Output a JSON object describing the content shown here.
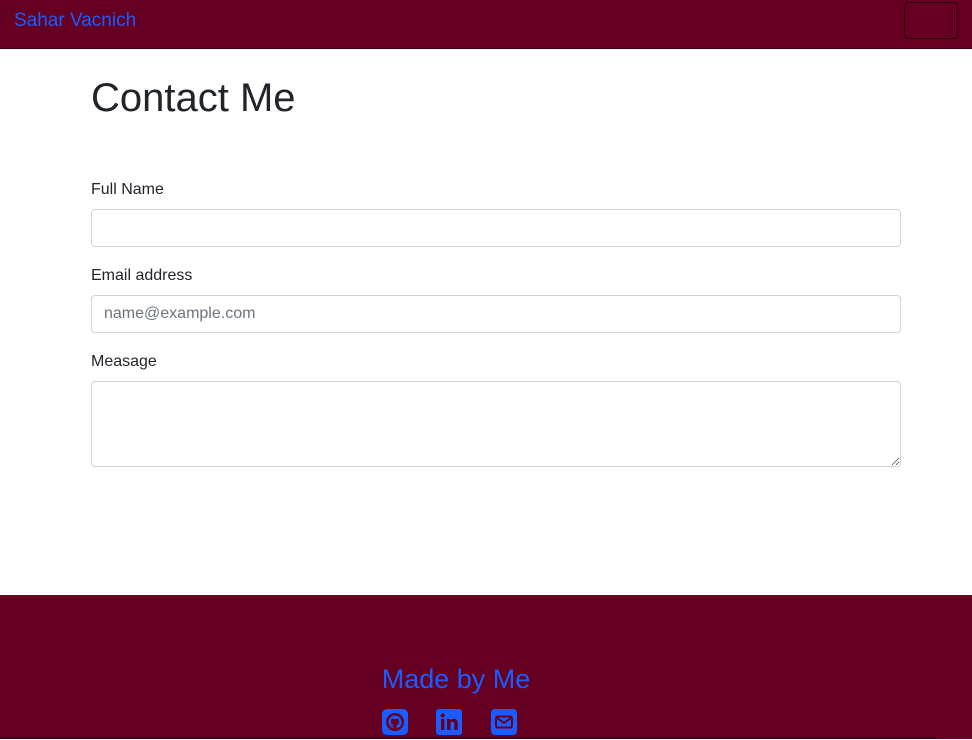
{
  "navbar": {
    "brand": "Sahar Vacnich"
  },
  "page": {
    "title": "Contact Me"
  },
  "form": {
    "full_name_label": "Full Name",
    "full_name_value": "",
    "email_label": "Email address",
    "email_placeholder": "name@example.com",
    "email_value": "",
    "message_label": "Measage",
    "message_value": ""
  },
  "footer": {
    "title": "Made by Me",
    "icons": [
      "github-icon",
      "linkedin-icon",
      "envelope-icon"
    ]
  },
  "colors": {
    "brand_bg": "#650022",
    "link": "#1a5cff"
  }
}
